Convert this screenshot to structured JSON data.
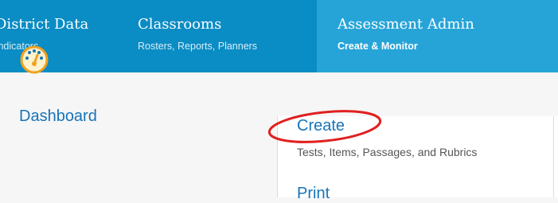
{
  "nav": {
    "tabs": [
      {
        "title": "District Data",
        "subtitle": "Indicators"
      },
      {
        "title": "Classrooms",
        "subtitle": "Rosters, Reports, Planners"
      },
      {
        "title": "Assessment Admin",
        "subtitle": "Create & Monitor"
      }
    ],
    "active_tab": "Assessment Admin",
    "colors": {
      "nav_bg": "#0a8cc4",
      "active_tab_bg": "#26a4d8",
      "link": "#1674b9",
      "annotation": "#e02020"
    }
  },
  "dashboard": {
    "icon": "gauge-icon",
    "label": "Dashboard"
  },
  "menu": {
    "items": [
      {
        "label": "Create",
        "description": "Tests, Items, Passages, and Rubrics"
      },
      {
        "label": "Print"
      }
    ]
  }
}
